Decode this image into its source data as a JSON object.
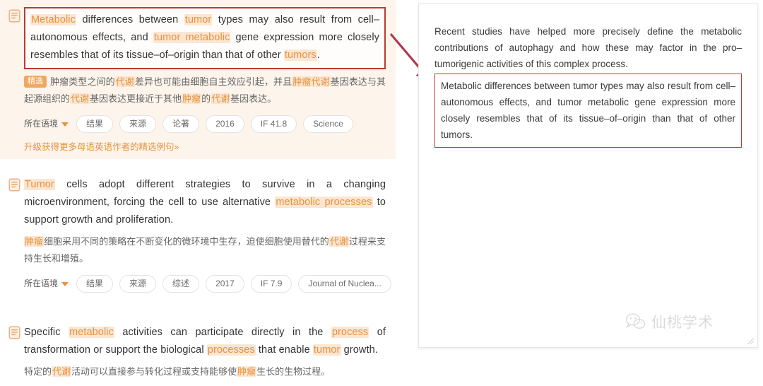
{
  "left_panel": {
    "entries": [
      {
        "icon": "document-icon",
        "featured": true,
        "english_parts": [
          {
            "t": "Metabolic",
            "hl": true
          },
          {
            "t": " differences between ",
            "hl": false
          },
          {
            "t": "tumor",
            "hl": true
          },
          {
            "t": " types may also result from cell–autonomous effects, and ",
            "hl": false
          },
          {
            "t": "tumor metabolic",
            "hl": true
          },
          {
            "t": " gene expression more closely resembles that of its tissue–of–origin than that of other ",
            "hl": false
          },
          {
            "t": "tumors",
            "hl": true
          },
          {
            "t": ".",
            "hl": false
          }
        ],
        "english_plain": "Metabolic differences between tumor types may also result from cell–autonomous effects, and tumor metabolic gene expression more closely resembles that of its tissue–of–origin than that of other tumors.",
        "badge": "精选",
        "chinese_parts": [
          {
            "t": "肿瘤类型之间的",
            "hl": false
          },
          {
            "t": "代谢",
            "hl": true
          },
          {
            "t": "差异也可能由细胞自主效应引起，并且",
            "hl": false
          },
          {
            "t": "肿瘤代谢",
            "hl": true
          },
          {
            "t": "基因表达与其起源组织的",
            "hl": false
          },
          {
            "t": "代谢",
            "hl": true
          },
          {
            "t": "基因表达更接近于其他",
            "hl": false
          },
          {
            "t": "肿瘤",
            "hl": true
          },
          {
            "t": "的",
            "hl": false
          },
          {
            "t": "代谢",
            "hl": true
          },
          {
            "t": "基因表达。",
            "hl": false
          }
        ],
        "tags": [
          {
            "label": "所在语境",
            "type": "context"
          },
          {
            "label": "结果",
            "type": "pill"
          },
          {
            "label": "来源",
            "type": "pill"
          },
          {
            "label": "论著",
            "type": "pill"
          },
          {
            "label": "2016",
            "type": "pill"
          },
          {
            "label": "IF 41.8",
            "type": "pill"
          },
          {
            "label": "Science",
            "type": "pill"
          }
        ],
        "upgrade_link": "升级获得更多母语英语作者的精选例句»"
      },
      {
        "icon": "document-icon",
        "featured": false,
        "english_parts": [
          {
            "t": "Tumor",
            "hl": true
          },
          {
            "t": " cells adopt different strategies to survive in a changing microenvironment, forcing the cell to use alternative ",
            "hl": false
          },
          {
            "t": "metabolic processes",
            "hl": true
          },
          {
            "t": " to support growth and proliferation.",
            "hl": false
          }
        ],
        "english_plain": "Tumor cells adopt different strategies to survive in a changing microenvironment, forcing the cell to use alternative metabolic processes to support growth and proliferation.",
        "badge": "",
        "chinese_parts": [
          {
            "t": "肿瘤",
            "hl": true
          },
          {
            "t": "细胞采用不同的策略在不断变化的微环境中生存，迫使细胞使用替代的",
            "hl": false
          },
          {
            "t": "代谢",
            "hl": true
          },
          {
            "t": "过程来支持生长和增殖。",
            "hl": false
          }
        ],
        "tags": [
          {
            "label": "所在语境",
            "type": "context"
          },
          {
            "label": "结果",
            "type": "pill"
          },
          {
            "label": "来源",
            "type": "pill"
          },
          {
            "label": "综述",
            "type": "pill"
          },
          {
            "label": "2017",
            "type": "pill"
          },
          {
            "label": "IF 7.9",
            "type": "pill"
          },
          {
            "label": "Journal of Nuclea...",
            "type": "pill"
          }
        ],
        "upgrade_link": ""
      },
      {
        "icon": "document-icon",
        "featured": false,
        "english_parts": [
          {
            "t": "Specific ",
            "hl": false
          },
          {
            "t": "metabolic",
            "hl": true
          },
          {
            "t": " activities can participate directly in the ",
            "hl": false
          },
          {
            "t": "process",
            "hl": true
          },
          {
            "t": " of transformation or support the biological ",
            "hl": false
          },
          {
            "t": "processes",
            "hl": true
          },
          {
            "t": " that enable ",
            "hl": false
          },
          {
            "t": "tumor",
            "hl": true
          },
          {
            "t": " growth.",
            "hl": false
          }
        ],
        "english_plain": "Specific metabolic activities can participate directly in the process of transformation or support the biological processes that enable tumor growth.",
        "badge": "",
        "chinese_parts": [
          {
            "t": "特定的",
            "hl": false
          },
          {
            "t": "代谢",
            "hl": true
          },
          {
            "t": "活动可以直接参与转化过程或支持能够使",
            "hl": false
          },
          {
            "t": "肿瘤",
            "hl": true
          },
          {
            "t": "生长的生物过程。",
            "hl": false
          }
        ],
        "tags": [],
        "upgrade_link": ""
      }
    ]
  },
  "right_panel": {
    "paragraph": "Recent studies have helped more precisely define the metabolic contributions of autophagy and how these may factor in the pro–tumorigenic activities of this complex process.",
    "highlighted_passage": "Metabolic differences between tumor types may also result from cell–autonomous effects, and tumor metabolic gene expression more closely resembles that of its tissue–of–origin than that of other tumors.",
    "resize_handle": "resize-grip-icon"
  },
  "watermark": {
    "text": "仙桃学术",
    "icon": "wechat-icon"
  },
  "colors": {
    "highlight_text": "#e8913a",
    "highlight_bg": "#fbe6d2",
    "annotation_box": "#c0392b",
    "featured_card_bg": "#fdf4ec",
    "body_text": "#333333",
    "chinese_text": "#666666"
  }
}
